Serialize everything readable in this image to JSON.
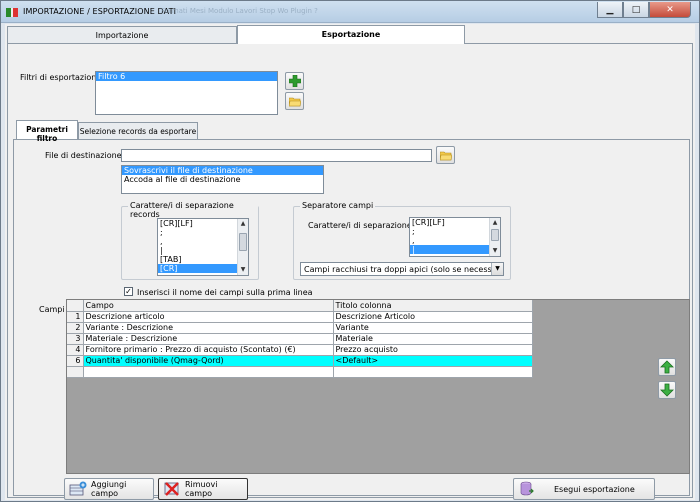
{
  "window": {
    "title": "IMPORTAZIONE / ESPORTAZIONE DATI",
    "background_menu_ghost": "Formati   Mesi   Modulo   Lavori   Stop   Wo   Plugin  ?"
  },
  "main_tabs": [
    {
      "label": "Importazione",
      "active": false
    },
    {
      "label": "Esportazione",
      "active": true
    }
  ],
  "filters": {
    "label": "Filtri di esportazione :",
    "items": [
      {
        "text": "Filtro 6",
        "selected": true
      }
    ]
  },
  "sub_tabs": [
    {
      "label": "Parametri filtro",
      "active": true
    },
    {
      "label": "Selezione records da esportare",
      "active": false
    }
  ],
  "destination": {
    "label": "File di destinazione :",
    "value": "",
    "mode_options": [
      {
        "text": "Sovrascrivi il file di destinazione",
        "selected": true
      },
      {
        "text": "Accoda al file di destinazione",
        "selected": false
      }
    ]
  },
  "record_separator": {
    "group_title": "Carattere/i di separazione records",
    "items": [
      {
        "text": "[CR][LF]",
        "selected": false
      },
      {
        "text": ";",
        "selected": false
      },
      {
        "text": ",",
        "selected": false
      },
      {
        "text": "|",
        "selected": false
      },
      {
        "text": "[TAB]",
        "selected": false
      },
      {
        "text": "[CR]",
        "selected": true
      }
    ]
  },
  "field_separator": {
    "group_title": "Separatore campi",
    "label": "Carattere/i di separazione :",
    "items": [
      {
        "text": "[CR][LF]",
        "selected": false
      },
      {
        "text": ";",
        "selected": false
      },
      {
        "text": ",",
        "selected": false
      },
      {
        "text": "|",
        "selected": true
      }
    ],
    "quote_option": "Campi racchiusi tra doppi apici (solo se necessario)"
  },
  "header_checkbox": {
    "label": "Inserisci il nome dei campi sulla prima linea",
    "checked": true
  },
  "fields_grid": {
    "label": "Campi :",
    "columns": [
      "Campo",
      "Titolo colonna"
    ],
    "rows": [
      {
        "num": "1",
        "campo": "Descrizione articolo",
        "titolo": "Descrizione Articolo",
        "highlight": false
      },
      {
        "num": "2",
        "campo": "Variante : Descrizione",
        "titolo": "Variante",
        "highlight": false
      },
      {
        "num": "3",
        "campo": "Materiale : Descrizione",
        "titolo": "Materiale",
        "highlight": false
      },
      {
        "num": "4",
        "campo": "Fornitore primario : Prezzo di acquisto (Scontato) (€)",
        "titolo": "Prezzo acquisto",
        "highlight": false
      },
      {
        "num": "6",
        "campo": "Quantita' disponibile (Qmag-Qord)",
        "titolo": "<Default>",
        "highlight": true
      }
    ]
  },
  "buttons": {
    "add_field": "Aggiungi campo",
    "remove_field": "Rimuovi campo",
    "run_export": "Esegui esportazione"
  },
  "colors": {
    "selection": "#3399ff",
    "highlight_row": "#00ffff",
    "add_green": "#2e9b2e",
    "remove_red": "#d22"
  }
}
